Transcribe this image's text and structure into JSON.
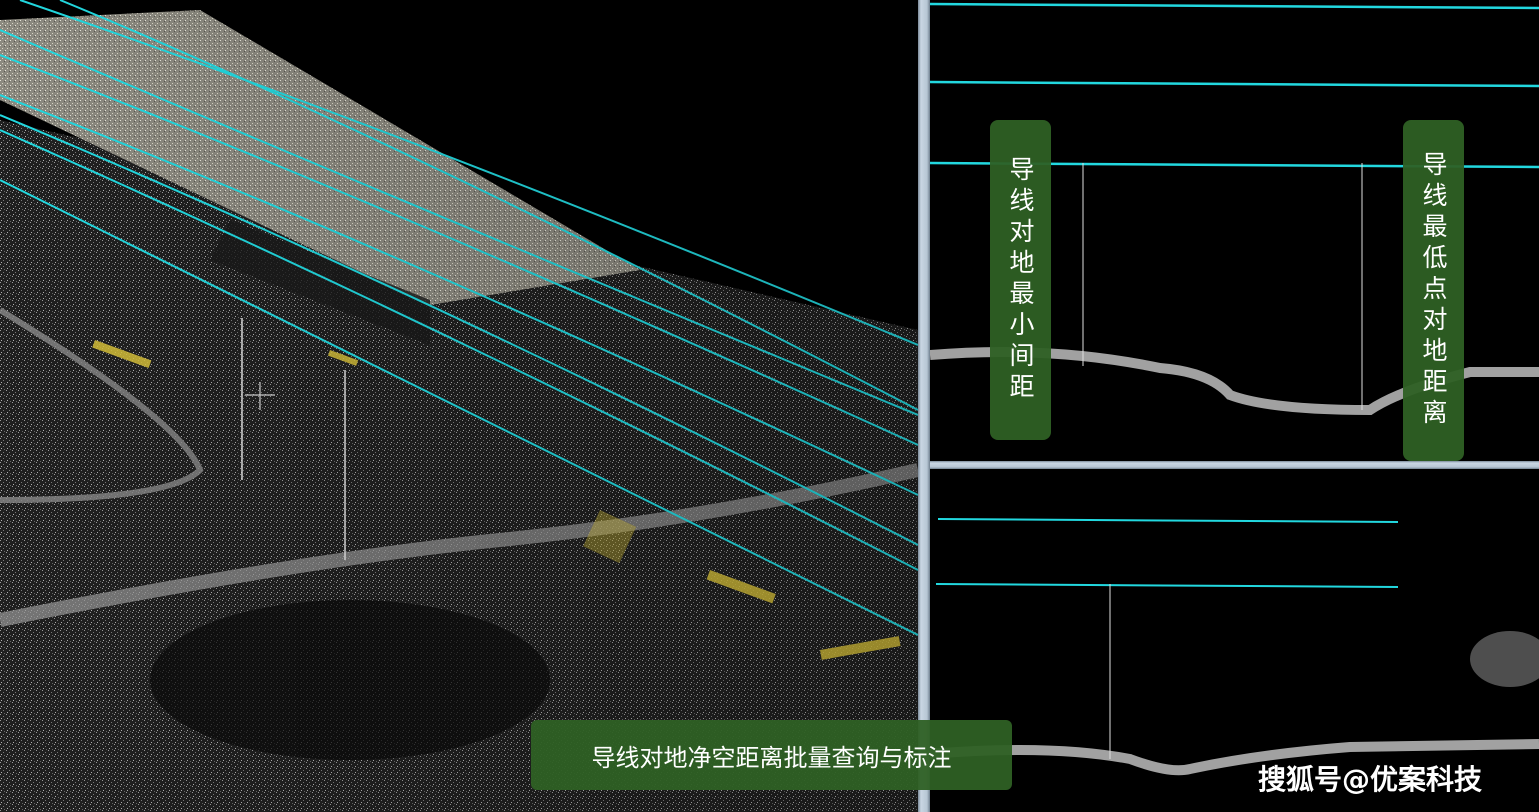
{
  "viewports": {
    "main_3d": "3d-point-cloud-view",
    "profile_top": "profile-view",
    "profile_bottom": "profile-view"
  },
  "labels": {
    "min_clearance": "导线对地最小间距",
    "lowest_point": "导线最低点对地距离"
  },
  "caption": "导线对地净空距离批量查询与标注",
  "watermark": "搜狐号@优案科技",
  "colors": {
    "conductor": "#22d8df",
    "ground_point": "#bdbdbd",
    "marking": "#d8c23a",
    "label_bg": "#2e6024"
  }
}
